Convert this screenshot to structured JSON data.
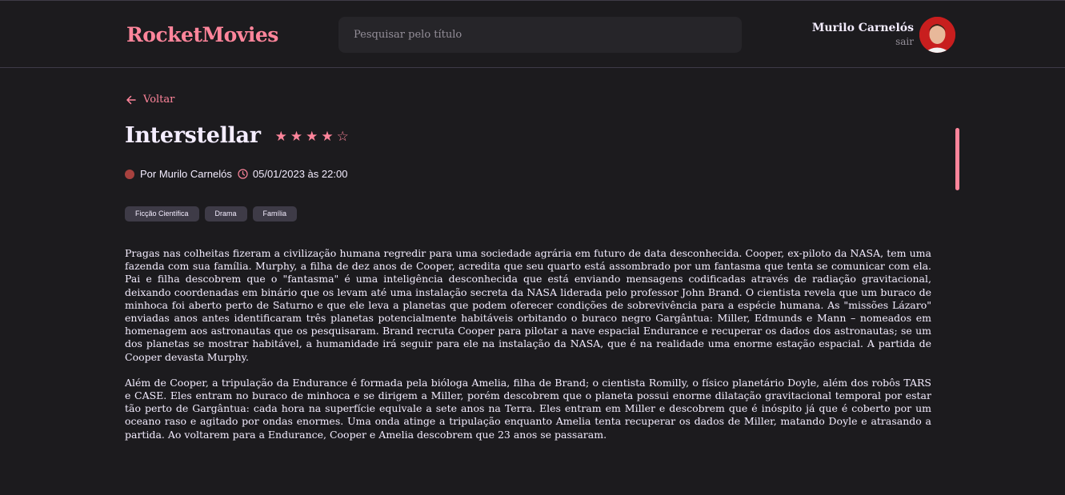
{
  "header": {
    "brand": "RocketMovies",
    "search_placeholder": "Pesquisar pelo título",
    "user_name": "Murilo Carnelós",
    "logout_label": "sair"
  },
  "nav": {
    "back_label": "Voltar"
  },
  "movie": {
    "title": "Interstellar",
    "rating": 4,
    "rating_max": 5,
    "author": "Por Murilo Carnelós",
    "datetime": "05/01/2023 às 22:00",
    "tags": [
      "Ficção Científica",
      "Drama",
      "Família"
    ],
    "description": [
      "Pragas nas colheitas fizeram a civilização humana regredir para uma sociedade agrária em futuro de data desconhecida. Cooper, ex-piloto da NASA, tem uma fazenda com sua família. Murphy, a filha de dez anos de Cooper, acredita que seu quarto está assombrado por um fantasma que tenta se comunicar com ela. Pai e filha descobrem que o \"fantasma\" é uma inteligência desconhecida que está enviando mensagens codificadas através de radiação gravitacional, deixando coordenadas em binário que os levam até uma instalação secreta da NASA liderada pelo professor John Brand. O cientista revela que um buraco de minhoca foi aberto perto de Saturno e que ele leva a planetas que podem oferecer condições de sobrevivência para a espécie humana. As \"missões Lázaro\" enviadas anos antes identificaram três planetas potencialmente habitáveis orbitando o buraco negro Gargântua: Miller, Edmunds e Mann – nomeados em homenagem aos astronautas que os pesquisaram. Brand recruta Cooper para pilotar a nave espacial Endurance e recuperar os dados dos astronautas; se um dos planetas se mostrar habitável, a humanidade irá seguir para ele na instalação da NASA, que é na realidade uma enorme estação espacial. A partida de Cooper devasta Murphy.",
      "Além de Cooper, a tripulação da Endurance é formada pela bióloga Amelia, filha de Brand; o cientista Romilly, o físico planetário Doyle, além dos robôs TARS e CASE. Eles entram no buraco de minhoca e se dirigem a Miller, porém descobrem que o planeta possui enorme dilatação gravitacional temporal por estar tão perto de Gargântua: cada hora na superfície equivale a sete anos na Terra. Eles entram em Miller e descobrem que é inóspito já que é coberto por um oceano raso e agitado por ondas enormes. Uma onda atinge a tripulação enquanto Amelia tenta recuperar os dados de Miller, matando Doyle e atrasando a partida. Ao voltarem para a Endurance, Cooper e Amelia descobrem que 23 anos se passaram."
    ]
  },
  "colors": {
    "accent": "#ff859b",
    "background": "#1c1b1e",
    "surface": "#262529",
    "tag_bg": "#3e3b47",
    "text": "#f4edff",
    "muted": "#948f99"
  }
}
